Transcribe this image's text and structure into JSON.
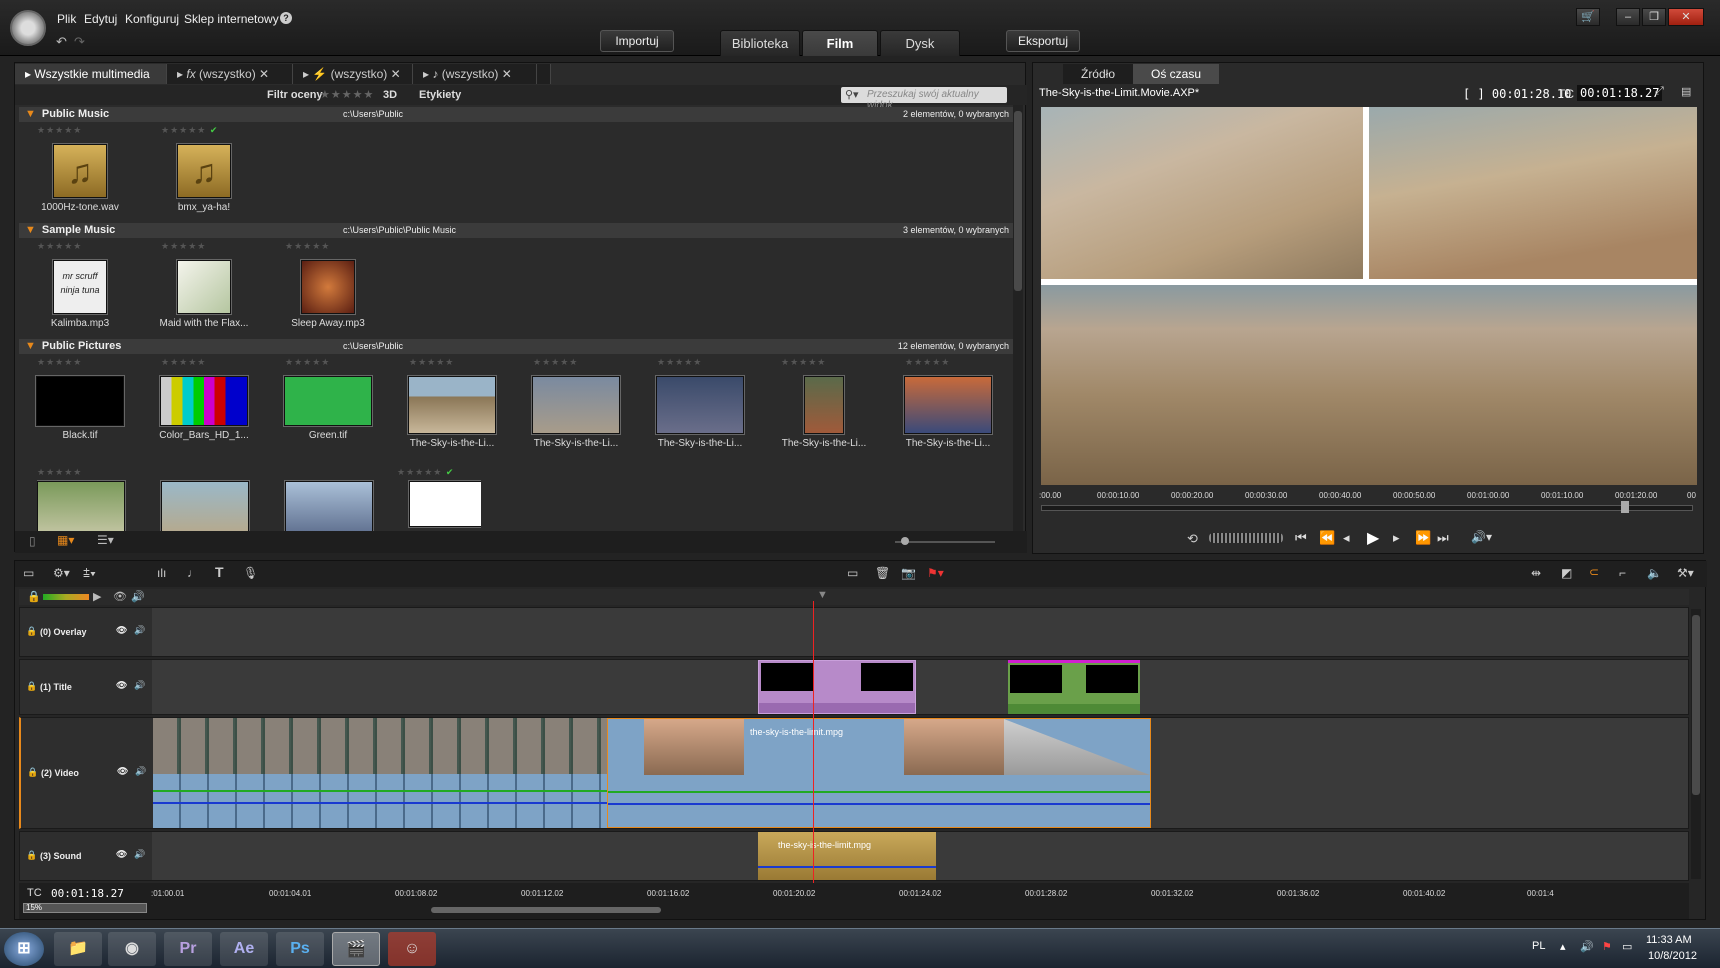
{
  "menu": {
    "file": "Plik",
    "edit": "Edytuj",
    "configure": "Konfiguruj",
    "shop": "Sklep internetowy",
    "help": "?"
  },
  "toolbar": {
    "import": "Importuj",
    "export": "Eksportuj"
  },
  "tabs": {
    "library": "Biblioteka",
    "movie": "Film",
    "disc": "Dysk"
  },
  "library": {
    "tabs": [
      "Wszystkie multimedia",
      "(wszystko)",
      "(wszystko)",
      "(wszystko)"
    ],
    "filter_label": "Filtr oceny",
    "threed": "3D",
    "tags": "Etykiety",
    "search_placeholder": "Przeszukaj swój aktualny widok",
    "sections": [
      {
        "name": "Public Music",
        "path": "c:\\Users\\Public",
        "count": "2 elementów, 0 wybranych",
        "items": [
          "1000Hz-tone.wav",
          "bmx_ya-ha!"
        ]
      },
      {
        "name": "Sample Music",
        "path": "c:\\Users\\Public\\Public Music",
        "count": "3 elementów, 0 wybranych",
        "items": [
          "Kalimba.mp3",
          "Maid with the Flax...",
          "Sleep Away.mp3"
        ]
      },
      {
        "name": "Public Pictures",
        "path": "c:\\Users\\Public",
        "count": "12 elementów, 0 wybranych",
        "items": [
          "Black.tif",
          "Color_Bars_HD_1...",
          "Green.tif",
          "The-Sky-is-the-Li...",
          "The-Sky-is-the-Li...",
          "The-Sky-is-the-Li...",
          "The-Sky-is-the-Li...",
          "The-Sky-is-the-Li..."
        ]
      }
    ]
  },
  "player": {
    "tab_source": "Źródło",
    "tab_timeline": "Oś czasu",
    "file": "The-Sky-is-the-Limit.Movie.AXP*",
    "duration": "[ ] 00:01:28.10",
    "tc_label": "TC",
    "tc": "00:01:18.27",
    "ruler": [
      ":00.00",
      "00:00:10.00",
      "00:00:20.00",
      "00:00:30.00",
      "00:00:40.00",
      "00:00:50.00",
      "00:01:00.00",
      "00:01:10.00",
      "00:01:20.00",
      "00"
    ],
    "playhead_fraction": 0.89
  },
  "timeline": {
    "tracks": [
      "(0) Overlay",
      "(1) Title",
      "(2) Video",
      "(3) Sound"
    ],
    "clip_video": "the-sky-is-the-limit.mpg",
    "clip_sound": "the-sky-is-the-limit.mpg",
    "tc_label": "TC",
    "tc": "00:01:18.27",
    "zoom": "15%",
    "ruler": [
      ":01:00.01",
      "00:01:04.01",
      "00:01:08.02",
      "00:01:12.02",
      "00:01:16.02",
      "00:01:20.02",
      "00:01:24.02",
      "00:01:28.02",
      "00:01:32.02",
      "00:01:36.02",
      "00:01:40.02",
      "00:01:4"
    ]
  },
  "taskbar": {
    "lang": "PL",
    "time": "11:33 AM",
    "date": "10/8/2012",
    "apps": [
      "Pr",
      "Ae",
      "Ps"
    ]
  }
}
